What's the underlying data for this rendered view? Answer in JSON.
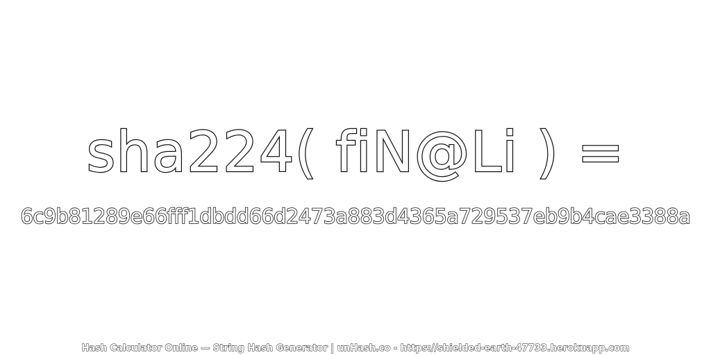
{
  "expression": "sha224( fiN@Li ) =",
  "hash": "6c9b81289e66fff1dbdd66d2473a883d4365a729537eb9b4cae3388a",
  "footer": "Hash Calculator Online — String Hash Generator | unHash.co - https://shielded-earth-47733.herokuapp.com",
  "colors": {
    "background": "#ffffff",
    "text_fill": "#ffffff",
    "text_outline": "#111111"
  }
}
